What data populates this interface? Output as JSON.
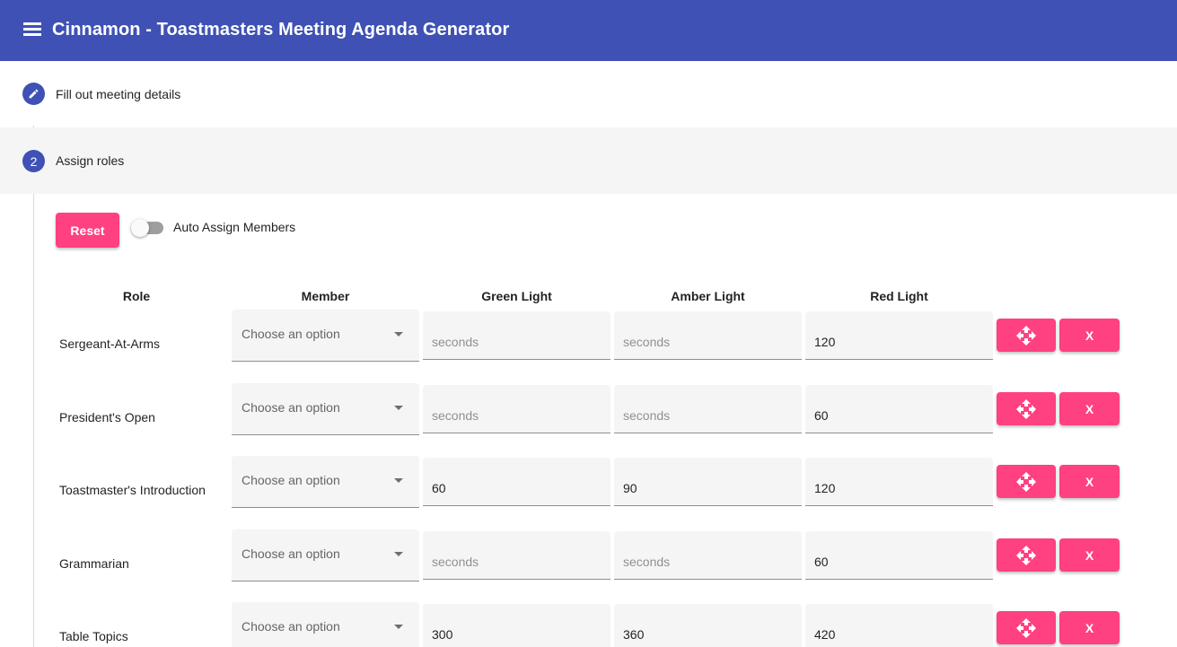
{
  "app": {
    "title": "Cinnamon - Toastmasters Meeting Agenda Generator"
  },
  "steps": [
    {
      "label": "Fill out meeting details",
      "icon": "pencil-icon"
    },
    {
      "number": "2",
      "label": "Assign roles"
    }
  ],
  "controls": {
    "reset_label": "Reset",
    "auto_assign_label": "Auto Assign Members",
    "auto_assign_on": false
  },
  "columns": {
    "role": "Role",
    "member": "Member",
    "green": "Green Light",
    "amber": "Amber Light",
    "red": "Red Light"
  },
  "placeholders": {
    "member": "Choose an option",
    "seconds": "seconds"
  },
  "actions": {
    "move_icon": "move-icon",
    "delete_label": "X"
  },
  "rows": [
    {
      "role": "Sergeant-At-Arms",
      "member": "",
      "green": "",
      "amber": "",
      "red": "120"
    },
    {
      "role": "President's Open",
      "member": "",
      "green": "",
      "amber": "",
      "red": "60"
    },
    {
      "role": "Toastmaster's Introduction",
      "member": "",
      "green": "60",
      "amber": "90",
      "red": "120"
    },
    {
      "role": "Grammarian",
      "member": "",
      "green": "",
      "amber": "",
      "red": "60"
    },
    {
      "role": "Table Topics",
      "member": "",
      "green": "300",
      "amber": "360",
      "red": "420"
    }
  ],
  "colors": {
    "primary": "#3f51b5",
    "accent": "#ff4081",
    "step_bg": "#f5f5f5"
  }
}
